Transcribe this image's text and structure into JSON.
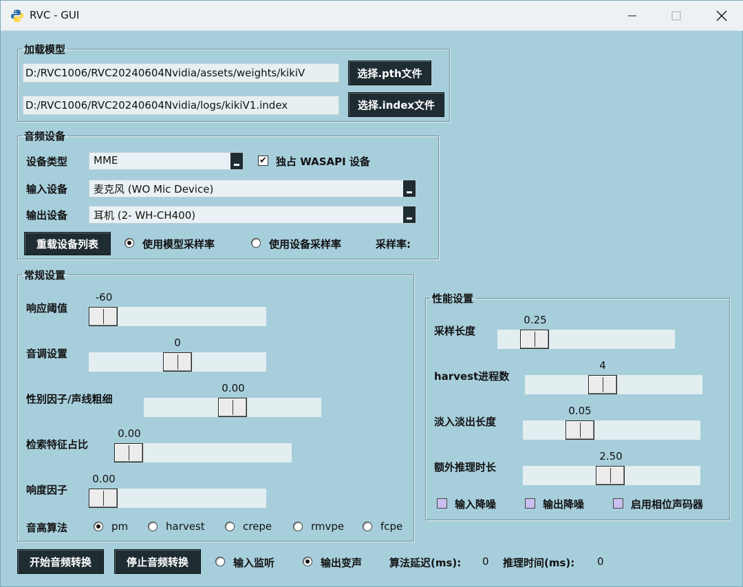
{
  "window": {
    "title": "RVC - GUI",
    "min_icon": "minimize-icon",
    "max_icon": "maximize-icon",
    "close_icon": "close-icon"
  },
  "load_model": {
    "legend": "加载模型",
    "pth_path": "D:/RVC1006/RVC20240604Nvidia/assets/weights/kikiV",
    "pth_button": "选择.pth文件",
    "index_path": "D:/RVC1006/RVC20240604Nvidia/logs/kikiV1.index",
    "index_button": "选择.index文件"
  },
  "audio_device": {
    "legend": "音频设备",
    "type_label": "设备类型",
    "type_value": "MME",
    "exclusive_label": "独占 WASAPI 设备",
    "input_label": "输入设备",
    "input_value": "麦克风 (WO Mic Device)",
    "output_label": "输出设备",
    "output_value": "耳机 (2- WH-CH400)",
    "reload_button": "重载设备列表",
    "use_model_sr": "使用模型采样率",
    "use_device_sr": "使用设备采样率",
    "sr_label": "采样率:"
  },
  "general": {
    "legend": "常规设置",
    "threshold_label": "响应阈值",
    "threshold_value": "-60",
    "threshold_level": 0.0,
    "pitch_label": "音调设置",
    "pitch_value": "0",
    "pitch_level": 0.5,
    "formant_label": "性别因子/声线粗细",
    "formant_value": "0.00",
    "formant_level": 0.5,
    "index_rate_label": "检索特征占比",
    "index_rate_value": "0.00",
    "index_rate_level": 0.0,
    "rms_label": "响度因子",
    "rms_value": "0.00",
    "rms_level": 0.0,
    "f0_label": "音高算法",
    "f0_options": [
      "pm",
      "harvest",
      "crepe",
      "rmvpe",
      "fcpe"
    ]
  },
  "performance": {
    "legend": "性能设置",
    "block_label": "采样长度",
    "block_value": "0.25",
    "nproc_label": "harvest进程数",
    "nproc_value": "4",
    "crossfade_label": "淡入淡出长度",
    "crossfade_value": "0.05",
    "extra_label": "额外推理时长",
    "extra_value": "2.50",
    "input_denoise": "输入降噪",
    "output_denoise": "输出降噪",
    "phase_vocoder": "启用相位声码器"
  },
  "bottom": {
    "start_button": "开始音频转换",
    "stop_button": "停止音频转换",
    "input_monitor": "输入监听",
    "output_voice": "输出变声",
    "delay_label": "算法延迟(ms):",
    "delay_value": "0",
    "infer_label": "推理时间(ms):",
    "infer_value": "0"
  }
}
